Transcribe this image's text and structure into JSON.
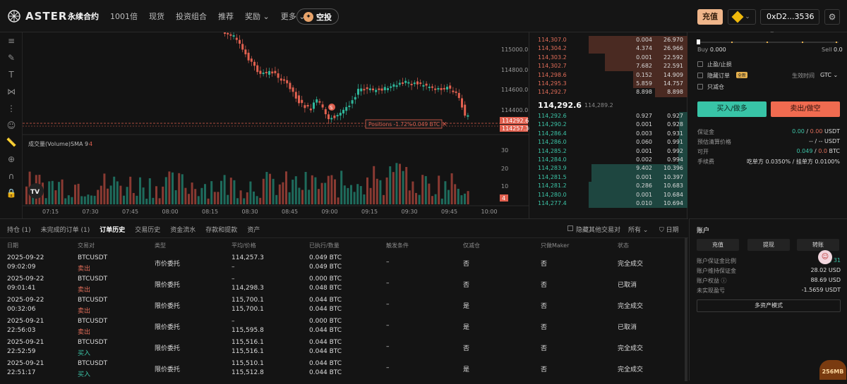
{
  "header": {
    "logo_text": "ASTER",
    "nav": [
      "永续合约",
      "1001倍",
      "现货",
      "投资组合",
      "推荐",
      "奖励",
      "更多"
    ],
    "airdrop_label": "空投",
    "deposit_label": "充值",
    "wallet_label": "0xD2...3536"
  },
  "chart": {
    "price_ticks": [
      "115000.0",
      "114800.0",
      "114600.0",
      "114400.0"
    ],
    "last_price_tag": "114292.6",
    "mark_price_tag": "114257.30",
    "position_label": "Positions -1.72%",
    "position_qty": "-0.049 BTC",
    "volume_label": "成交量(Volume)",
    "sma_label": "SMA 9",
    "sma_value": "4",
    "volume_ticks": [
      "30",
      "20",
      "10"
    ],
    "volume_last": "4",
    "time_ticks": [
      "07:15",
      "07:30",
      "07:45",
      "08:00",
      "08:15",
      "08:30",
      "08:45",
      "09:00",
      "09:15",
      "09:30",
      "09:45",
      "10:00"
    ],
    "marker_label": "S",
    "tv_logo": "TV",
    "candle_colors": {
      "up": "#2fb79b",
      "down": "#e0604f"
    }
  },
  "orderbook": {
    "asks": [
      {
        "price": "114,307.0",
        "qty": "0.004",
        "total": "26.970"
      },
      {
        "price": "114,304.2",
        "qty": "4.374",
        "total": "26.966"
      },
      {
        "price": "114,303.2",
        "qty": "0.001",
        "total": "22.592"
      },
      {
        "price": "114,302.7",
        "qty": "7.682",
        "total": "22.591"
      },
      {
        "price": "114,298.6",
        "qty": "0.152",
        "total": "14.909"
      },
      {
        "price": "114,295.3",
        "qty": "5.859",
        "total": "14.757"
      },
      {
        "price": "114,292.7",
        "qty": "8.898",
        "total": "8.898"
      }
    ],
    "mid_price": "114,292.6",
    "mark_price": "114,289.2",
    "bids": [
      {
        "price": "114,292.6",
        "qty": "0.927",
        "total": "0.927"
      },
      {
        "price": "114,290.2",
        "qty": "0.001",
        "total": "0.928"
      },
      {
        "price": "114,286.4",
        "qty": "0.003",
        "total": "0.931"
      },
      {
        "price": "114,286.0",
        "qty": "0.060",
        "total": "0.991"
      },
      {
        "price": "114,285.2",
        "qty": "0.001",
        "total": "0.992"
      },
      {
        "price": "114,284.0",
        "qty": "0.002",
        "total": "0.994"
      },
      {
        "price": "114,283.9",
        "qty": "9.402",
        "total": "10.396"
      },
      {
        "price": "114,281.5",
        "qty": "0.001",
        "total": "10.397"
      },
      {
        "price": "114,281.2",
        "qty": "0.286",
        "total": "10.683"
      },
      {
        "price": "114,280.0",
        "qty": "0.001",
        "total": "10.684"
      },
      {
        "price": "114,277.4",
        "qty": "0.010",
        "total": "10.694"
      }
    ]
  },
  "order_panel": {
    "buy_label": "Buy",
    "buy_value": "0.000",
    "sell_label": "Sell",
    "sell_value": "0.0",
    "tpsl_label": "止盈/止损",
    "hidden_label": "隐藏订单",
    "hidden_badge": "全新",
    "tif_label": "生效时间",
    "tif_value": "GTC",
    "reduce_label": "只减仓",
    "buy_btn": "买入/做多",
    "sell_btn": "卖出/做空",
    "margin_label": "保证金",
    "margin_value_a": "0.00",
    "margin_value_b": "0.00",
    "margin_unit": "USDT",
    "liq_label": "预估清算价格",
    "liq_value": "-- / -- USDT",
    "avail_label": "可开",
    "avail_a": "0.049",
    "avail_b": "0.0",
    "avail_unit": "BTC",
    "fee_label": "手续费",
    "fee_value": "吃单方 0.0350% / 挂单方 0.0100%"
  },
  "bottom": {
    "tabs": [
      "持仓 (1)",
      "未完成的订单 (1)",
      "订单历史",
      "交易历史",
      "资金流水",
      "存款和提款",
      "资产"
    ],
    "hide_other": "隐藏其他交易对",
    "filter_all": "所有",
    "date_filter": "日期",
    "columns": [
      "日期",
      "交易对",
      "类型",
      "平均/价格",
      "已执行/数量",
      "触发条件",
      "仅减仓",
      "只做Maker",
      "状态"
    ],
    "rows": [
      {
        "date": "2025-09-22",
        "time": "09:02:09",
        "pair": "BTCUSDT",
        "side": "卖出",
        "type": "市价委托",
        "avg": "114,257.3",
        "price": "–",
        "filled": "0.049 BTC",
        "qty": "0.049 BTC",
        "trigger": "–",
        "reduce": "否",
        "maker": "否",
        "status": "完全成交"
      },
      {
        "date": "2025-09-22",
        "time": "09:01:41",
        "pair": "BTCUSDT",
        "side": "卖出",
        "type": "限价委托",
        "avg": "–",
        "price": "114,298.3",
        "filled": "0.000 BTC",
        "qty": "0.048 BTC",
        "trigger": "–",
        "reduce": "否",
        "maker": "否",
        "status": "已取消"
      },
      {
        "date": "2025-09-22",
        "time": "00:32:06",
        "pair": "BTCUSDT",
        "side": "卖出",
        "type": "限价委托",
        "avg": "115,700.1",
        "price": "115,700.1",
        "filled": "0.044 BTC",
        "qty": "0.044 BTC",
        "trigger": "–",
        "reduce": "是",
        "maker": "否",
        "status": "完全成交"
      },
      {
        "date": "2025-09-21",
        "time": "22:56:03",
        "pair": "BTCUSDT",
        "side": "卖出",
        "type": "限价委托",
        "avg": "–",
        "price": "115,595.8",
        "filled": "0.000 BTC",
        "qty": "0.044 BTC",
        "trigger": "–",
        "reduce": "是",
        "maker": "否",
        "status": "已取消"
      },
      {
        "date": "2025-09-21",
        "time": "22:52:59",
        "pair": "BTCUSDT",
        "side": "买入",
        "type": "限价委托",
        "avg": "115,516.1",
        "price": "115,516.1",
        "filled": "0.044 BTC",
        "qty": "0.044 BTC",
        "trigger": "–",
        "reduce": "否",
        "maker": "否",
        "status": "完全成交"
      },
      {
        "date": "2025-09-21",
        "time": "22:51:17",
        "pair": "BTCUSDT",
        "side": "买入",
        "type": "限价委托",
        "avg": "115,510.1",
        "price": "115,512.8",
        "filled": "0.044 BTC",
        "qty": "0.044 BTC",
        "trigger": "–",
        "reduce": "是",
        "maker": "否",
        "status": "完全成交"
      }
    ]
  },
  "account": {
    "title": "账户",
    "btn_deposit": "充值",
    "btn_withdraw": "提现",
    "btn_transfer": "转账",
    "margin_ratio_label": "账户保证金比例",
    "margin_ratio_value": "31",
    "maint_label": "账户维持保证金",
    "maint_value": "28.02 USD",
    "equity_label": "账户权益",
    "equity_value": "88.69 USD",
    "upnl_label": "未实现盈亏",
    "upnl_value": "-1.5659 USDT",
    "multi_label": "多资产模式",
    "badge_value": "256MB"
  }
}
